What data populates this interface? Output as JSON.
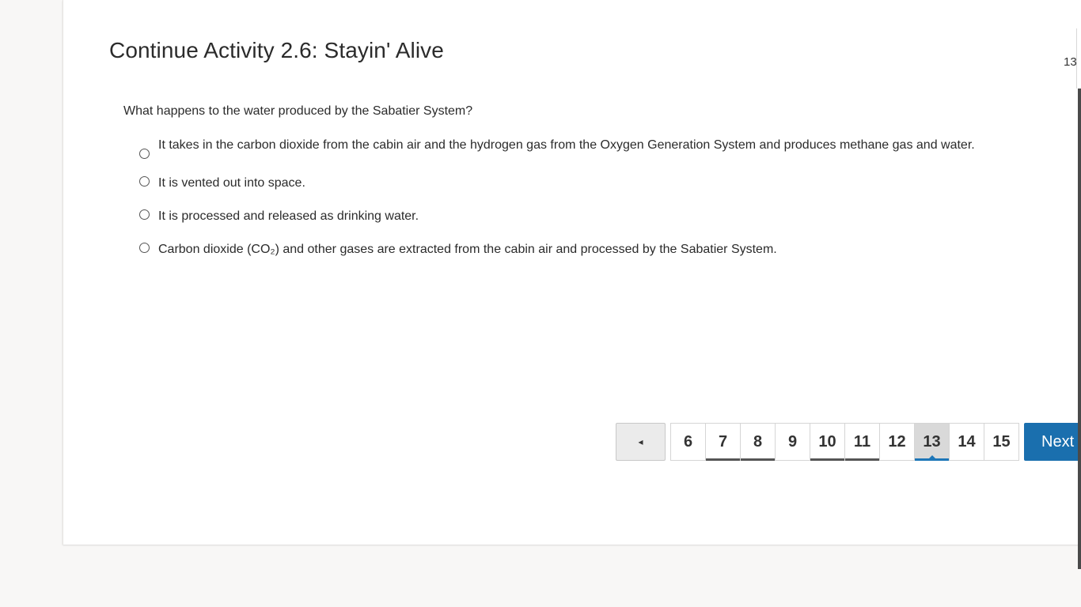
{
  "activity": {
    "title": "Continue Activity 2.6: Stayin' Alive",
    "page_counter": "13"
  },
  "question": {
    "prompt": "What happens to the water produced by the Sabatier System?",
    "options": [
      {
        "label": "It takes in the carbon dioxide from the cabin air and the hydrogen gas from the Oxygen Generation System and produces methane gas and water.",
        "selected": false
      },
      {
        "label": "It is vented out into space.",
        "selected": false
      },
      {
        "label": "It is processed and released as drinking water.",
        "selected": false
      },
      {
        "label": "Carbon dioxide (CO₂) and other gases are extracted from the cabin air and processed by the Sabatier System.",
        "selected": false
      }
    ]
  },
  "pagination": {
    "prev_icon": "left-triangle-icon",
    "prev_glyph": "◂",
    "pages": [
      {
        "label": "6",
        "state": "default"
      },
      {
        "label": "7",
        "state": "visited"
      },
      {
        "label": "8",
        "state": "visited"
      },
      {
        "label": "9",
        "state": "default"
      },
      {
        "label": "10",
        "state": "visited"
      },
      {
        "label": "11",
        "state": "visited"
      },
      {
        "label": "12",
        "state": "default"
      },
      {
        "label": "13",
        "state": "current"
      },
      {
        "label": "14",
        "state": "default"
      },
      {
        "label": "15",
        "state": "default"
      }
    ],
    "next_label": "Next"
  },
  "colors": {
    "accent": "#1a6fae",
    "visited_underline": "#555555",
    "background": "#f8f7f6"
  }
}
